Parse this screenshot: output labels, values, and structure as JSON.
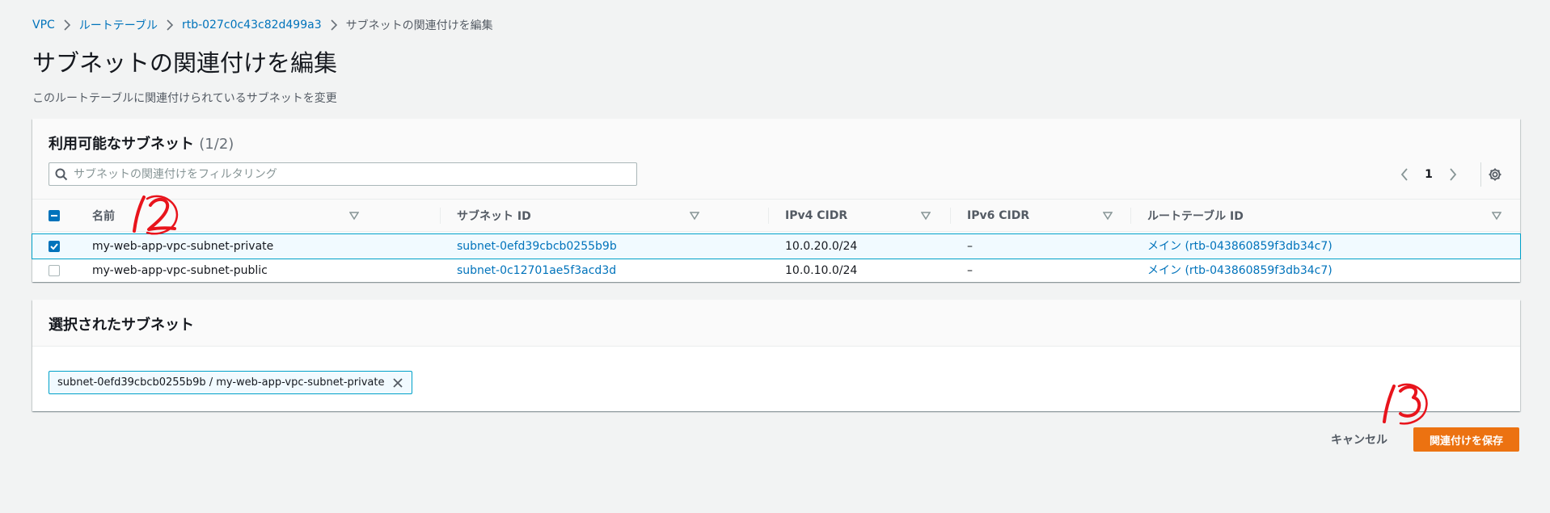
{
  "breadcrumb": {
    "items": [
      "VPC",
      "ルートテーブル",
      "rtb-027c0c43c82d499a3",
      "サブネットの関連付けを編集"
    ]
  },
  "page": {
    "title": "サブネットの関連付けを編集",
    "description": "このルートテーブルに関連付けられているサブネットを変更"
  },
  "available": {
    "title": "利用可能なサブネット",
    "count": "(1/2)",
    "filter_placeholder": "サブネットの関連付けをフィルタリング",
    "page_number": "1",
    "columns": [
      "名前",
      "サブネット ID",
      "IPv4 CIDR",
      "IPv6 CIDR",
      "ルートテーブル ID"
    ],
    "rows": [
      {
        "name": "my-web-app-vpc-subnet-private",
        "subnet_id": "subnet-0efd39cbcb0255b9b",
        "ipv4": "10.0.20.0/24",
        "ipv6": "–",
        "route_table": "メイン (rtb-043860859f3db34c7)",
        "checked": true
      },
      {
        "name": "my-web-app-vpc-subnet-public",
        "subnet_id": "subnet-0c12701ae5f3acd3d",
        "ipv4": "10.0.10.0/24",
        "ipv6": "–",
        "route_table": "メイン (rtb-043860859f3db34c7)",
        "checked": false
      }
    ]
  },
  "selected": {
    "title": "選択されたサブネット",
    "token": "subnet-0efd39cbcb0255b9b / my-web-app-vpc-subnet-private"
  },
  "actions": {
    "cancel": "キャンセル",
    "save": "関連付けを保存"
  },
  "annotations": [
    "12",
    "13"
  ],
  "colors": {
    "link": "#0073bb",
    "primary": "#ec7211",
    "selected_row": "#f1faff",
    "selected_border": "#00a1c9",
    "annotation": "#e8141c"
  },
  "icons": [
    "chevron-right-icon",
    "search-icon",
    "chevron-left-icon",
    "chevron-right-icon",
    "gear-icon",
    "sort-caret-icon",
    "check-icon",
    "minus-icon",
    "close-icon"
  ]
}
